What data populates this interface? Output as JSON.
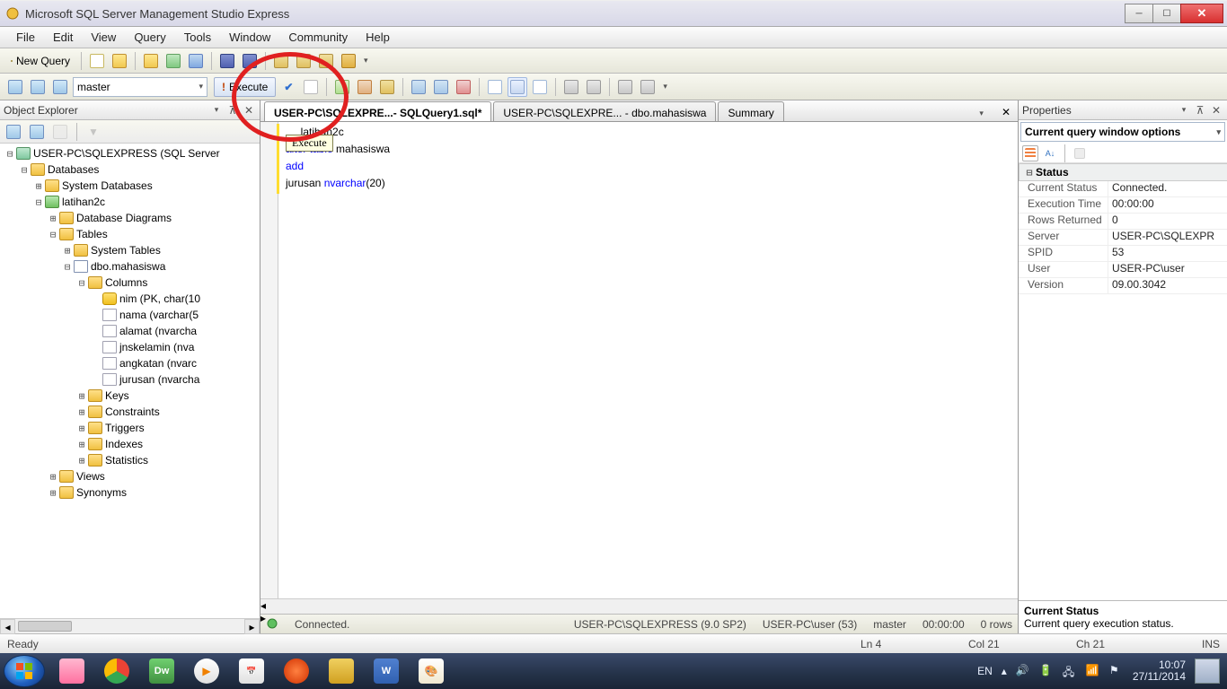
{
  "title": "Microsoft SQL Server Management Studio Express",
  "menu": [
    "File",
    "Edit",
    "View",
    "Query",
    "Tools",
    "Window",
    "Community",
    "Help"
  ],
  "toolbar1": {
    "newQuery": "New Query"
  },
  "toolbar2": {
    "database": "master",
    "executeLabel": "Execute",
    "tooltip": "Execute"
  },
  "explorer": {
    "title": "Object Explorer",
    "root": "USER-PC\\SQLEXPRESS (SQL Server",
    "items": [
      {
        "l": 1,
        "t": "-",
        "ic": "folder",
        "txt": "Databases"
      },
      {
        "l": 2,
        "t": "+",
        "ic": "folder",
        "txt": "System Databases"
      },
      {
        "l": 2,
        "t": "-",
        "ic": "dbic",
        "txt": "latihan2c"
      },
      {
        "l": 3,
        "t": "+",
        "ic": "folder",
        "txt": "Database Diagrams"
      },
      {
        "l": 3,
        "t": "-",
        "ic": "folder",
        "txt": "Tables"
      },
      {
        "l": 4,
        "t": "+",
        "ic": "folder",
        "txt": "System Tables"
      },
      {
        "l": 4,
        "t": "-",
        "ic": "tbic",
        "txt": "dbo.mahasiswa"
      },
      {
        "l": 5,
        "t": "-",
        "ic": "folder",
        "txt": "Columns"
      },
      {
        "l": 6,
        "t": " ",
        "ic": "key",
        "txt": "nim (PK, char(10"
      },
      {
        "l": 6,
        "t": " ",
        "ic": "col",
        "txt": "nama (varchar(5"
      },
      {
        "l": 6,
        "t": " ",
        "ic": "col",
        "txt": "alamat (nvarcha"
      },
      {
        "l": 6,
        "t": " ",
        "ic": "col",
        "txt": "jnskelamin (nva"
      },
      {
        "l": 6,
        "t": " ",
        "ic": "col",
        "txt": "angkatan (nvarc"
      },
      {
        "l": 6,
        "t": " ",
        "ic": "col",
        "txt": "jurusan (nvarcha"
      },
      {
        "l": 5,
        "t": "+",
        "ic": "folder",
        "txt": "Keys"
      },
      {
        "l": 5,
        "t": "+",
        "ic": "folder",
        "txt": "Constraints"
      },
      {
        "l": 5,
        "t": "+",
        "ic": "folder",
        "txt": "Triggers"
      },
      {
        "l": 5,
        "t": "+",
        "ic": "folder",
        "txt": "Indexes"
      },
      {
        "l": 5,
        "t": "+",
        "ic": "folder",
        "txt": "Statistics"
      },
      {
        "l": 3,
        "t": "+",
        "ic": "folder",
        "txt": "Views"
      },
      {
        "l": 3,
        "t": "+",
        "ic": "folder",
        "txt": "Synonyms"
      }
    ]
  },
  "tabs": {
    "active": "USER-PC\\SQLEXPRE...- SQLQuery1.sql*",
    "others": [
      "USER-PC\\SQLEXPRE... - dbo.mahasiswa",
      "Summary"
    ]
  },
  "sql": {
    "lines": [
      [
        {
          "c": "gray",
          "t": "     "
        },
        {
          "c": "",
          "t": "latihan2c"
        }
      ],
      [
        {
          "c": "kw",
          "t": "alter table"
        },
        {
          "c": "",
          "t": " mahasiswa"
        }
      ],
      [
        {
          "c": "kw",
          "t": "add"
        }
      ],
      [
        {
          "c": "",
          "t": "jurusan "
        },
        {
          "c": "kw",
          "t": "nvarchar"
        },
        {
          "c": "",
          "t": "(20)"
        }
      ]
    ]
  },
  "editorStatus": {
    "conn": "Connected.",
    "server": "USER-PC\\SQLEXPRESS (9.0 SP2)",
    "user": "USER-PC\\user (53)",
    "db": "master",
    "time": "00:00:00",
    "rows": "0 rows"
  },
  "props": {
    "title": "Properties",
    "combo": "Current query window options",
    "cat": "Status",
    "rows": [
      {
        "n": "Current Status",
        "v": "Connected."
      },
      {
        "n": "Execution Time",
        "v": "00:00:00"
      },
      {
        "n": "Rows Returned",
        "v": "0"
      },
      {
        "n": "Server",
        "v": "USER-PC\\SQLEXPR"
      },
      {
        "n": "SPID",
        "v": "53"
      },
      {
        "n": "User",
        "v": "USER-PC\\user"
      },
      {
        "n": "Version",
        "v": "09.00.3042"
      }
    ],
    "descTitle": "Current Status",
    "descText": "Current query execution status."
  },
  "status": {
    "ready": "Ready",
    "ln": "Ln 4",
    "col": "Col 21",
    "ch": "Ch 21",
    "ins": "INS"
  },
  "tray": {
    "lang": "EN",
    "time": "10:07",
    "date": "27/11/2014"
  }
}
